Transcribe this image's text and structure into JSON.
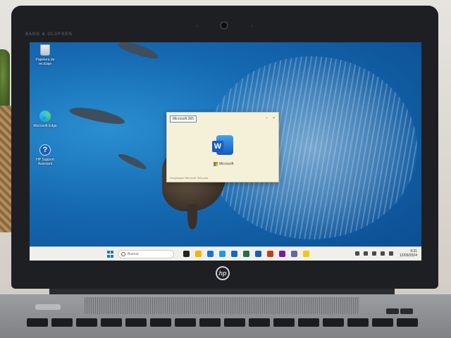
{
  "laptop": {
    "bezel_brand": "BANG & OLUFSEN",
    "logo": "hp"
  },
  "desktop": {
    "icons": [
      {
        "label": "Papelera de reciclaje",
        "icon": "recycle-bin-icon"
      },
      {
        "label": "Microsoft Edge",
        "icon": "edge-icon"
      },
      {
        "label": "HP Support Assistant",
        "icon": "hp-support-icon"
      }
    ]
  },
  "splash": {
    "title": "Microsoft 365",
    "brand": "Microsoft",
    "footer": "Despliegue Microsoft 365 para"
  },
  "taskbar": {
    "search_placeholder": "Buscar",
    "time": "9:31",
    "date": "12/09/2024",
    "apps": [
      "widgets-icon",
      "file-explorer-icon",
      "store-icon",
      "edge-icon",
      "outlook-icon",
      "excel-icon",
      "word-icon",
      "powerpoint-icon",
      "onenote-icon",
      "teams-icon",
      "notes-icon"
    ],
    "app_colors": [
      "#222222",
      "#f4b400",
      "#1a73d9",
      "#1e9be6",
      "#0f6cbd",
      "#1e7145",
      "#185abd",
      "#c43e1c",
      "#7719aa",
      "#6264a7",
      "#f2c811"
    ]
  }
}
